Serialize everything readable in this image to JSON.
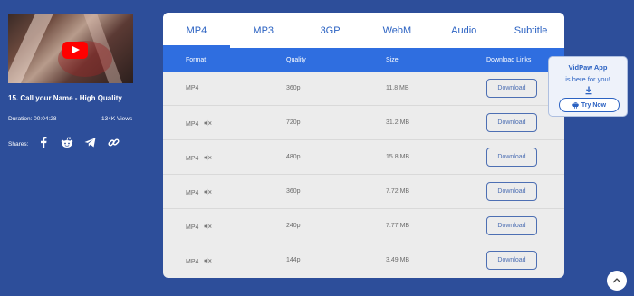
{
  "video": {
    "title": "15. Call your Name - High Quality",
    "duration": "Duration: 00:04:28",
    "views": "134K Views",
    "shares_label": "Shares:"
  },
  "share_icons": [
    "facebook-icon",
    "reddit-icon",
    "telegram-icon",
    "link-icon"
  ],
  "tabs": [
    {
      "label": "MP4",
      "active": true
    },
    {
      "label": "MP3"
    },
    {
      "label": "3GP"
    },
    {
      "label": "WebM"
    },
    {
      "label": "Audio"
    },
    {
      "label": "Subtitle"
    }
  ],
  "table": {
    "headers": {
      "format": "Format",
      "quality": "Quality",
      "size": "Size",
      "links": "Download Links"
    },
    "rows": [
      {
        "format": "MP4",
        "muted": false,
        "quality": "360p",
        "size": "11.8 MB",
        "button": "Download"
      },
      {
        "format": "MP4",
        "muted": true,
        "quality": "720p",
        "size": "31.2 MB",
        "button": "Download"
      },
      {
        "format": "MP4",
        "muted": true,
        "quality": "480p",
        "size": "15.8 MB",
        "button": "Download"
      },
      {
        "format": "MP4",
        "muted": true,
        "quality": "360p",
        "size": "7.72 MB",
        "button": "Download"
      },
      {
        "format": "MP4",
        "muted": true,
        "quality": "240p",
        "size": "7.77 MB",
        "button": "Download"
      },
      {
        "format": "MP4",
        "muted": true,
        "quality": "144p",
        "size": "3.49 MB",
        "button": "Download"
      }
    ]
  },
  "promo": {
    "title": "VidPaw App",
    "subtitle": "is here for you!",
    "button": "Try Now"
  },
  "colors": {
    "background": "#2d4e9a",
    "accent": "#2f6ee0",
    "tab_text": "#2b62c2"
  }
}
